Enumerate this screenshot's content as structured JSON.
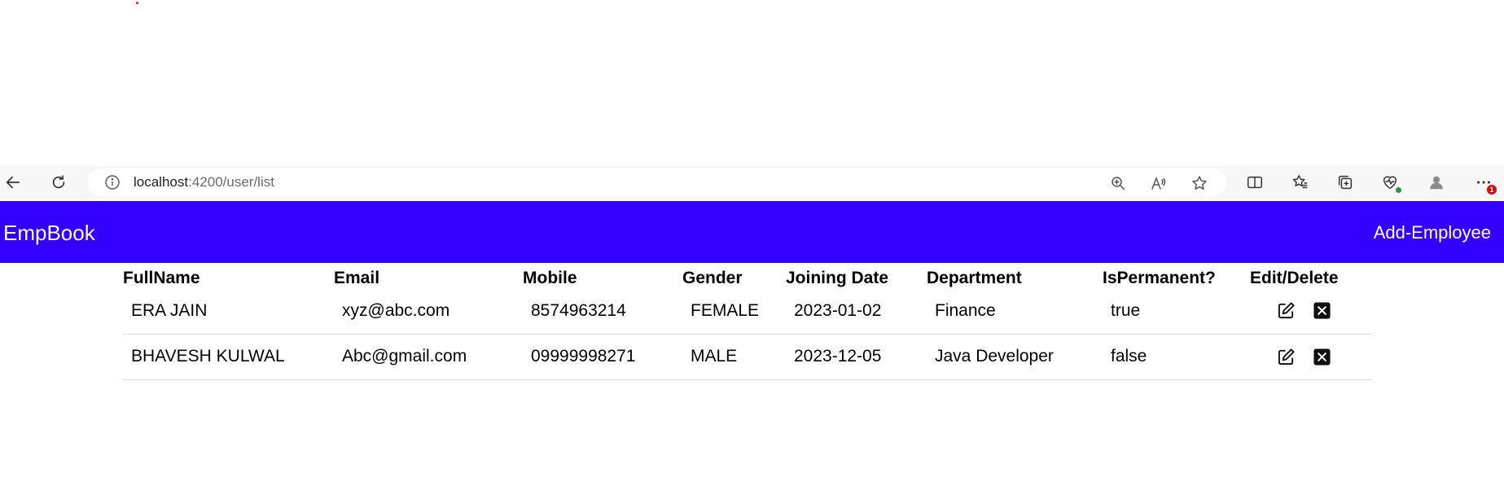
{
  "browser": {
    "url_host": "localhost",
    "url_rest": ":4200/user/list",
    "notification_count": "1"
  },
  "navbar": {
    "brand": "EmpBook",
    "add_link": "Add-Employee"
  },
  "table": {
    "headers": [
      "FullName",
      "Email",
      "Mobile",
      "Gender",
      "Joining Date",
      "Department",
      "IsPermanent?",
      "Edit/Delete"
    ],
    "rows": [
      {
        "fullname": "ERA JAIN",
        "email": "xyz@abc.com",
        "mobile": "8574963214",
        "gender": "FEMALE",
        "joining_date": "2023-01-02",
        "department": "Finance",
        "is_permanent": "true"
      },
      {
        "fullname": "BHAVESH KULWAL",
        "email": "Abc@gmail.com",
        "mobile": "09999998271",
        "gender": "MALE",
        "joining_date": "2023-12-05",
        "department": "Java Developer",
        "is_permanent": "false"
      }
    ]
  },
  "colors": {
    "navbar_bg": "#3300ff",
    "navbar_text": "#ffffff"
  },
  "icons": {
    "back": "back-arrow-icon",
    "refresh": "refresh-icon",
    "info": "info-icon",
    "zoom": "zoom-icon",
    "read_aloud": "read-aloud-icon",
    "favorite": "star-icon",
    "split": "split-screen-icon",
    "favorites": "favorites-icon",
    "collections": "collections-icon",
    "health": "browser-essentials-icon",
    "profile": "profile-icon",
    "more": "more-icon",
    "edit": "edit-icon",
    "delete": "delete-icon"
  }
}
